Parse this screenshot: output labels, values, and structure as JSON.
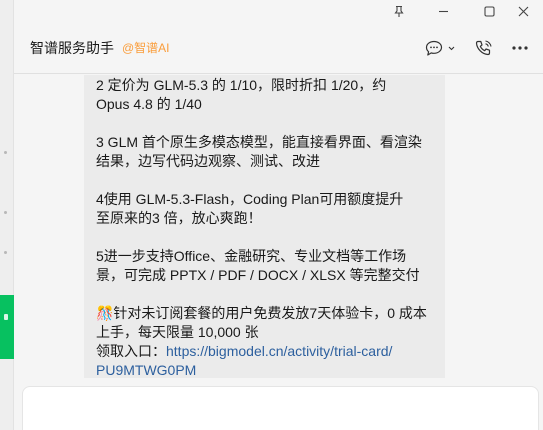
{
  "header": {
    "title": "智谱服务助手",
    "mention": "@智谱AI"
  },
  "message": {
    "paragraphs": [
      {
        "lines": [
          "2 定价为 GLM-5.3 的 1/10，限时折扣 1/20，约",
          "Opus 4.8 的 1/40"
        ]
      },
      {
        "lines": [
          "3 GLM 首个原生多模态模型，能直接看界面、看渲染",
          "结果，边写代码边观察、测试、改进"
        ]
      },
      {
        "lines": [
          "4使用 GLM-5.3-Flash，Coding Plan可用额度提升",
          "至原来的3 倍，放心爽跑！"
        ]
      },
      {
        "lines": [
          "5进一步支持Office、金融研究、专业文档等工作场",
          "景，可完成 PPTX / PDF / DOCX / XLSX 等完整交付"
        ]
      }
    ],
    "promo": {
      "lines": [
        "🎊针对未订阅套餐的用户免费发放7天体验卡，0 成本",
        "上手，每天限量 10,000 张"
      ],
      "link_prefix": "领取入口：",
      "link_line1": "https://bigmodel.cn/activity/trial-card/",
      "link_line2": "PU9MTWG0PM"
    }
  },
  "icons": {
    "pin": "pin-icon",
    "minimize": "minimize-icon",
    "maximize": "maximize-icon",
    "close": "close-icon",
    "chat_bubble": "chat-bubble-icon",
    "dropdown": "chevron-down-icon",
    "call": "phone-call-icon",
    "more": "more-icon"
  },
  "colors": {
    "accent": "#07c160",
    "mention": "#fa9d3b",
    "link": "#2c5f9e",
    "bubble": "#ebebeb"
  }
}
